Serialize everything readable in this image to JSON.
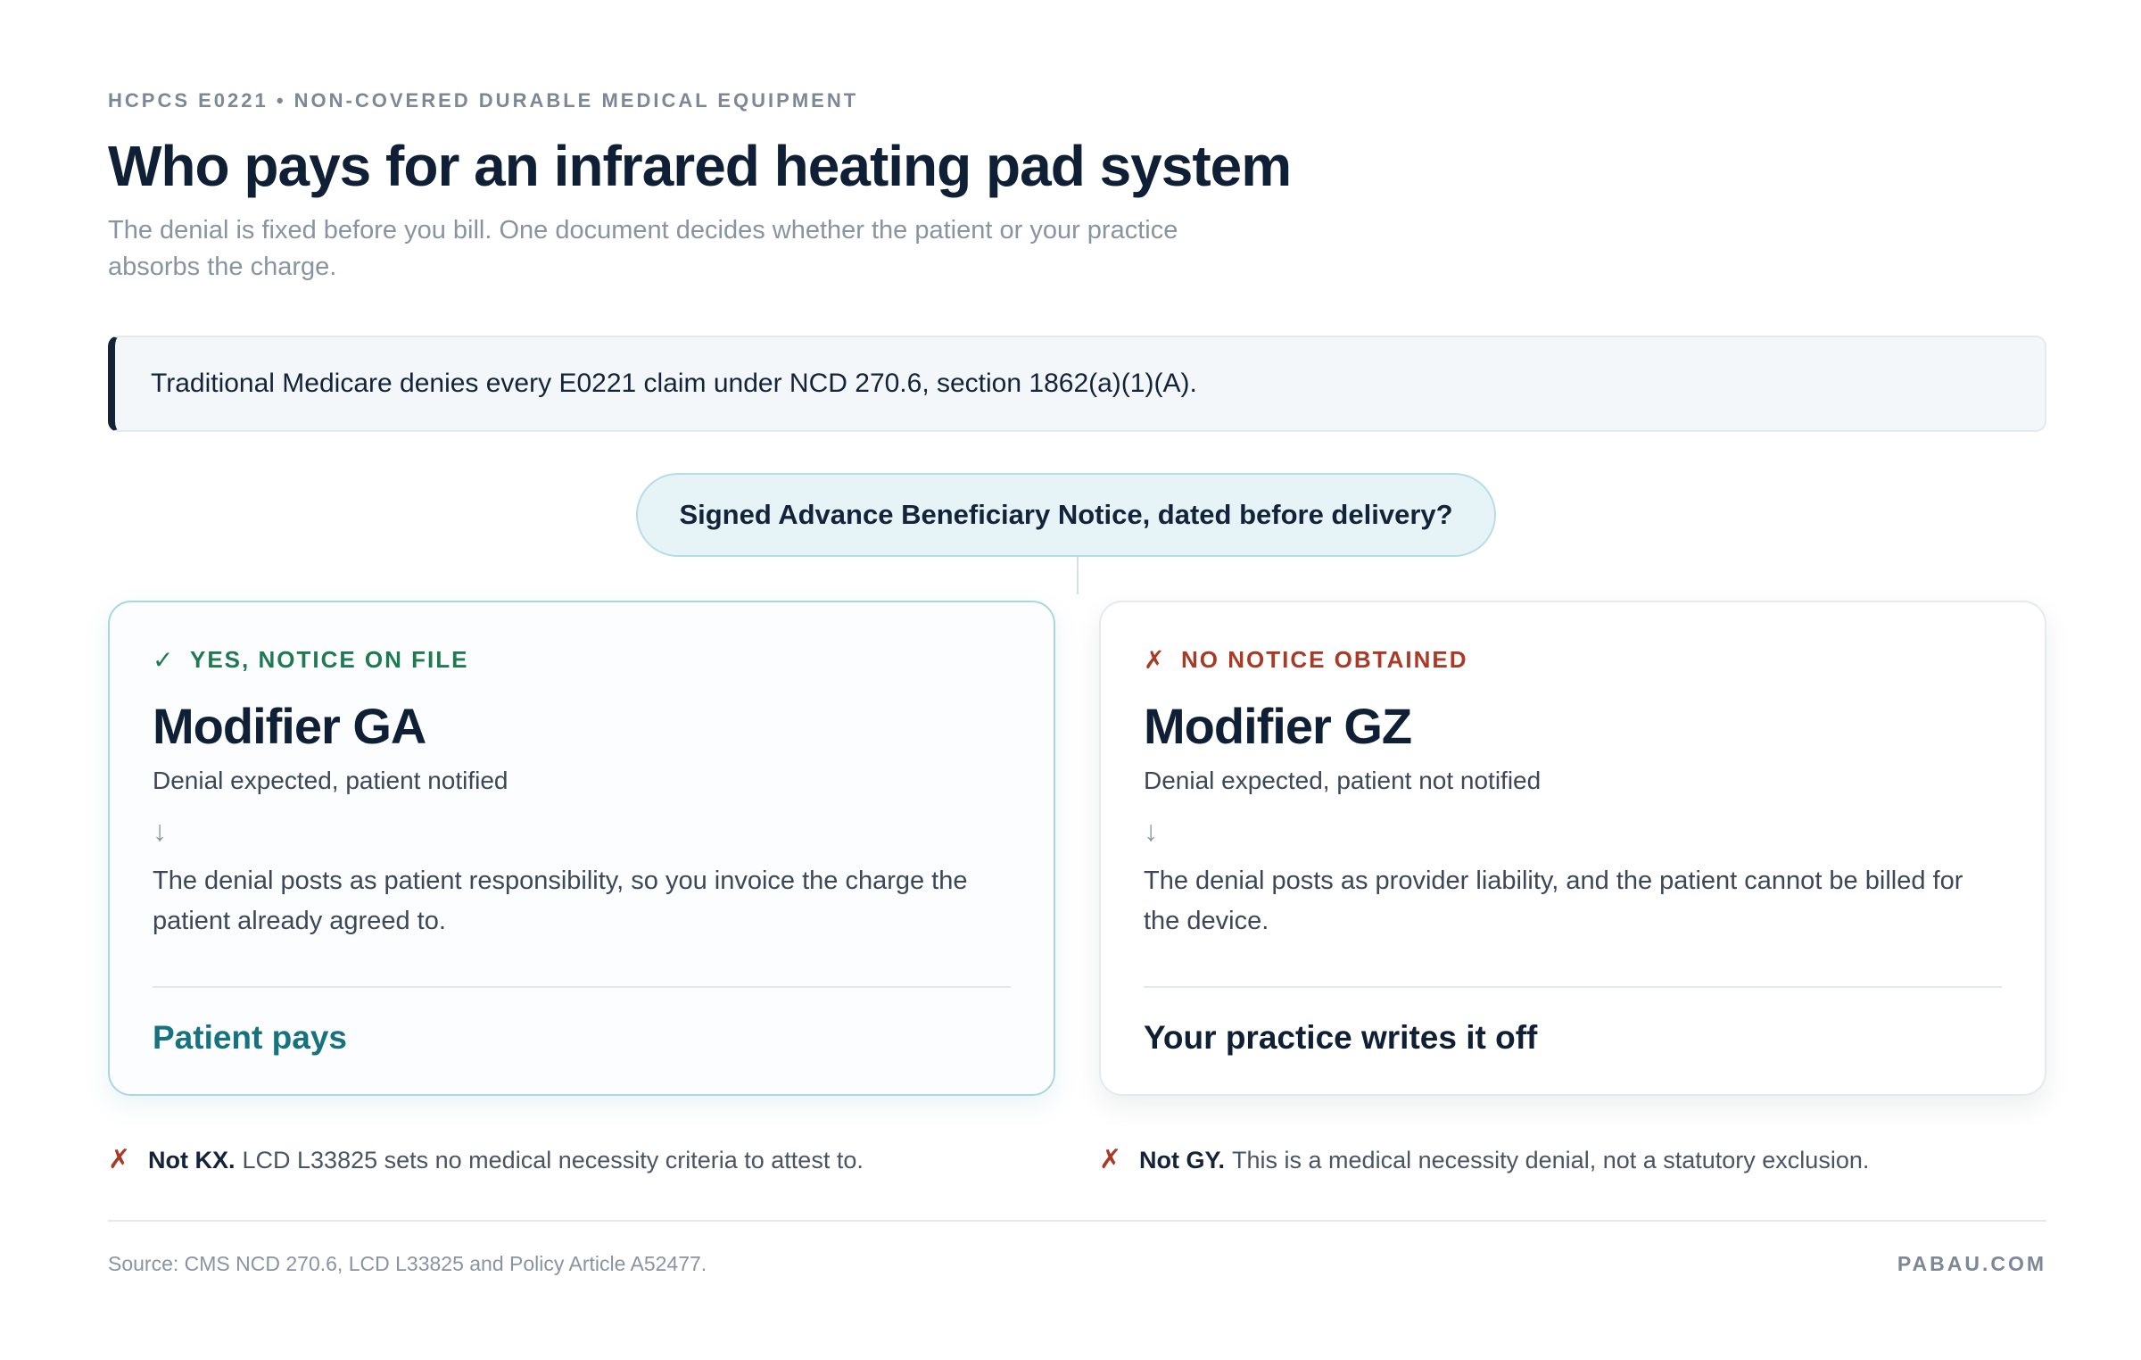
{
  "header": {
    "eyebrow": "HCPCS E0221 • NON-COVERED DURABLE MEDICAL EQUIPMENT",
    "title": "Who pays for an infrared heating pad system",
    "subtitle": "The denial is fixed before you bill. One document decides whether the patient or your practice absorbs the charge."
  },
  "rule": {
    "text": "Traditional Medicare denies every E0221 claim under NCD 270.6, section 1862(a)(1)(A)."
  },
  "question": {
    "text": "Signed Advance Beneficiary Notice, dated before delivery?"
  },
  "branches": [
    {
      "icon": "check-icon",
      "icon_glyph": "✓",
      "status": "YES, NOTICE ON FILE",
      "modifier": "Modifier GA",
      "meaning": "Denial expected, patient notified",
      "arrow": "↓",
      "description": "The denial posts as patient responsibility, so you invoice the charge the patient already agreed to.",
      "outcome": "Patient pays",
      "colors": {
        "status": "#1f7a52",
        "outcome": "#17727f"
      }
    },
    {
      "icon": "cross-icon",
      "icon_glyph": "✗",
      "status": "NO NOTICE OBTAINED",
      "modifier": "Modifier GZ",
      "meaning": "Denial expected, patient not notified",
      "arrow": "↓",
      "description": "The denial posts as provider liability, and the patient cannot be billed for the device.",
      "outcome": "Your practice writes it off",
      "colors": {
        "status": "#a83a26",
        "outcome": "#0f1f35"
      }
    }
  ],
  "notes": [
    {
      "icon": "cross-icon",
      "icon_glyph": "✗",
      "bold": "Not KX.",
      "text": "LCD L33825 sets no medical necessity criteria to attest to."
    },
    {
      "icon": "cross-icon",
      "icon_glyph": "✗",
      "bold": "Not GY.",
      "text": "This is a medical necessity denial, not a statutory exclusion."
    }
  ],
  "footer": {
    "source": "Source: CMS NCD 270.6, LCD L33825 and Policy Article A52477.",
    "brand": "PABAU.COM"
  }
}
